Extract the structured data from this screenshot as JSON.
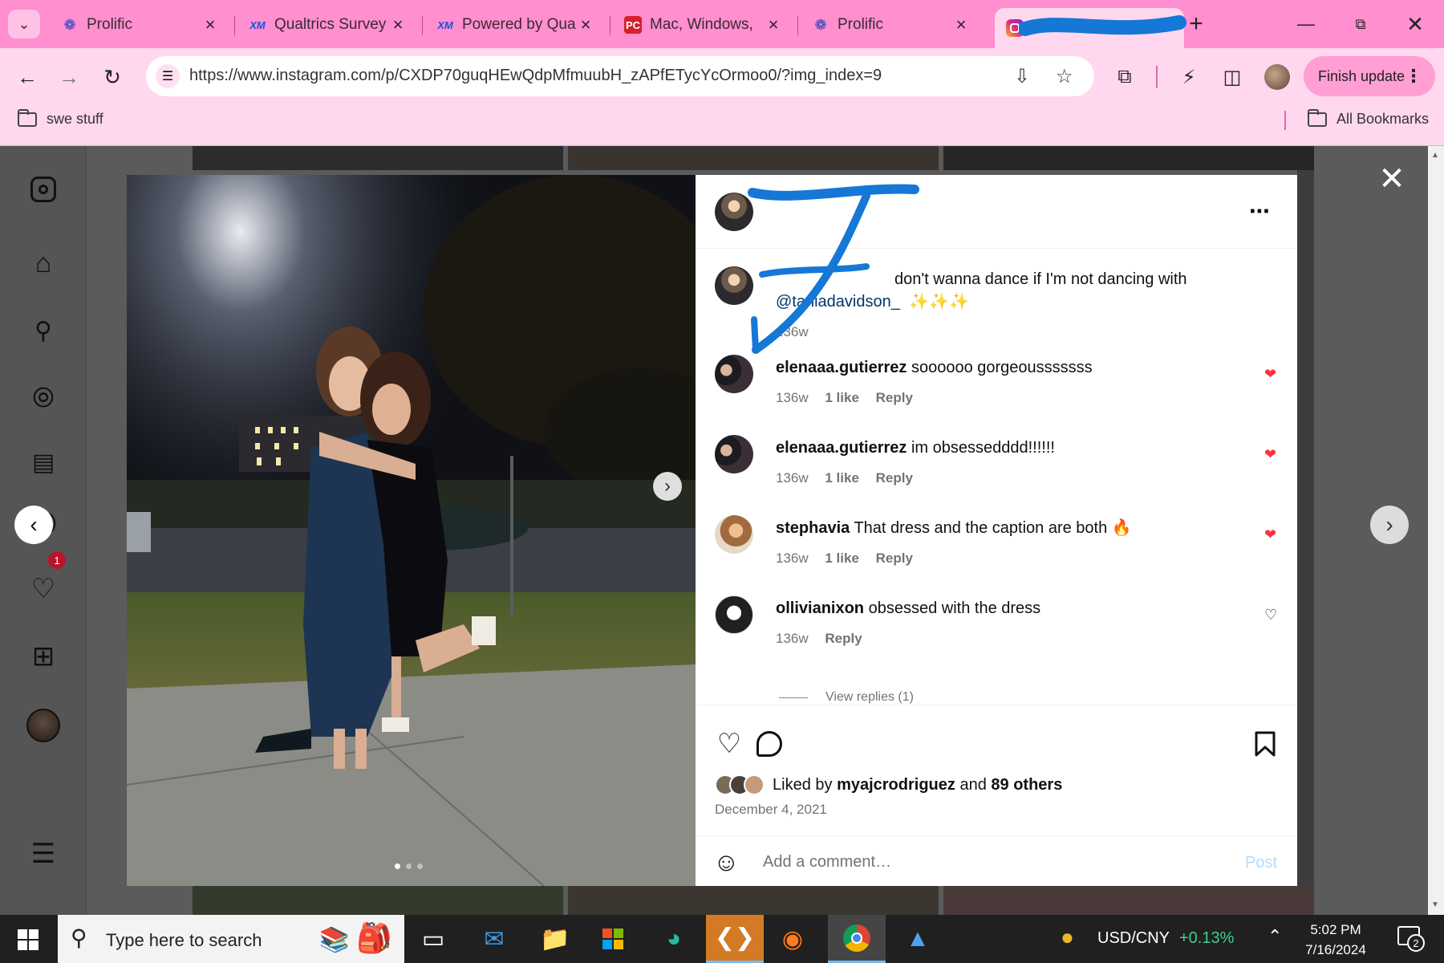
{
  "browser": {
    "tabs": [
      {
        "title": "Prolific",
        "favicon": "prolific-icon"
      },
      {
        "title": "Qualtrics Survey",
        "favicon": "xm-icon"
      },
      {
        "title": "Powered by Qua",
        "favicon": "xm-icon"
      },
      {
        "title": "Mac, Windows, ",
        "favicon": "pc-icon"
      },
      {
        "title": "Prolific",
        "favicon": "prolific-icon"
      },
      {
        "title": "",
        "favicon": "instagram-icon",
        "active": true
      }
    ],
    "url": "https://www.instagram.com/p/CXDP70guqHEwQdpMfmuubH_zAPfETycYcOrmoo0/?img_index=9",
    "finish_update_label": "Finish update",
    "bookmarks": {
      "left": "swe stuff",
      "right": "All Bookmarks"
    },
    "accent_color": "#ff8fcf"
  },
  "instagram": {
    "sidebar_icons": [
      "instagram-logo-icon",
      "home-icon",
      "search-icon",
      "explore-icon",
      "reels-icon",
      "messenger-icon",
      "heart-icon",
      "create-icon",
      "profile-avatar",
      "menu-icon"
    ],
    "notification_count": "1",
    "post": {
      "author": {
        "username": ""
      },
      "caption": {
        "username": "",
        "text": "don't wanna dance if I'm not dancing with",
        "mention": "@taniadavidson_",
        "emojis": "✨✨✨",
        "time": "136w"
      },
      "comments": [
        {
          "username": "elenaaa.gutierrez",
          "text": "soooooo gorgeousssssss",
          "time": "136w",
          "likes": "1 like",
          "reply": "Reply",
          "liked": true
        },
        {
          "username": "elenaaa.gutierrez",
          "text": "im obsessedddd!!!!!!",
          "time": "136w",
          "likes": "1 like",
          "reply": "Reply",
          "liked": true
        },
        {
          "username": "stephavia",
          "text": "That dress and the caption are both 🔥",
          "time": "136w",
          "likes": "1 like",
          "reply": "Reply",
          "liked": true
        },
        {
          "username": "ollivianixon",
          "text": "obsessed with the dress",
          "time": "136w",
          "likes": "",
          "reply": "Reply",
          "liked": false
        }
      ],
      "view_replies": "View replies (1)",
      "liked_by": {
        "prefix": "Liked by",
        "user": "myajcrodriguez",
        "middle": "and",
        "others": "89 others"
      },
      "date": "December 4, 2021",
      "add_comment_placeholder": "Add a comment…",
      "post_button": "Post",
      "carousel_index": 1,
      "carousel_total": 3
    }
  },
  "taskbar": {
    "search_placeholder": "Type here to search",
    "currency_label": "USD/CNY",
    "currency_change": "+0.13%",
    "time": "5:02 PM",
    "date": "7/16/2024",
    "notifications": "2"
  }
}
